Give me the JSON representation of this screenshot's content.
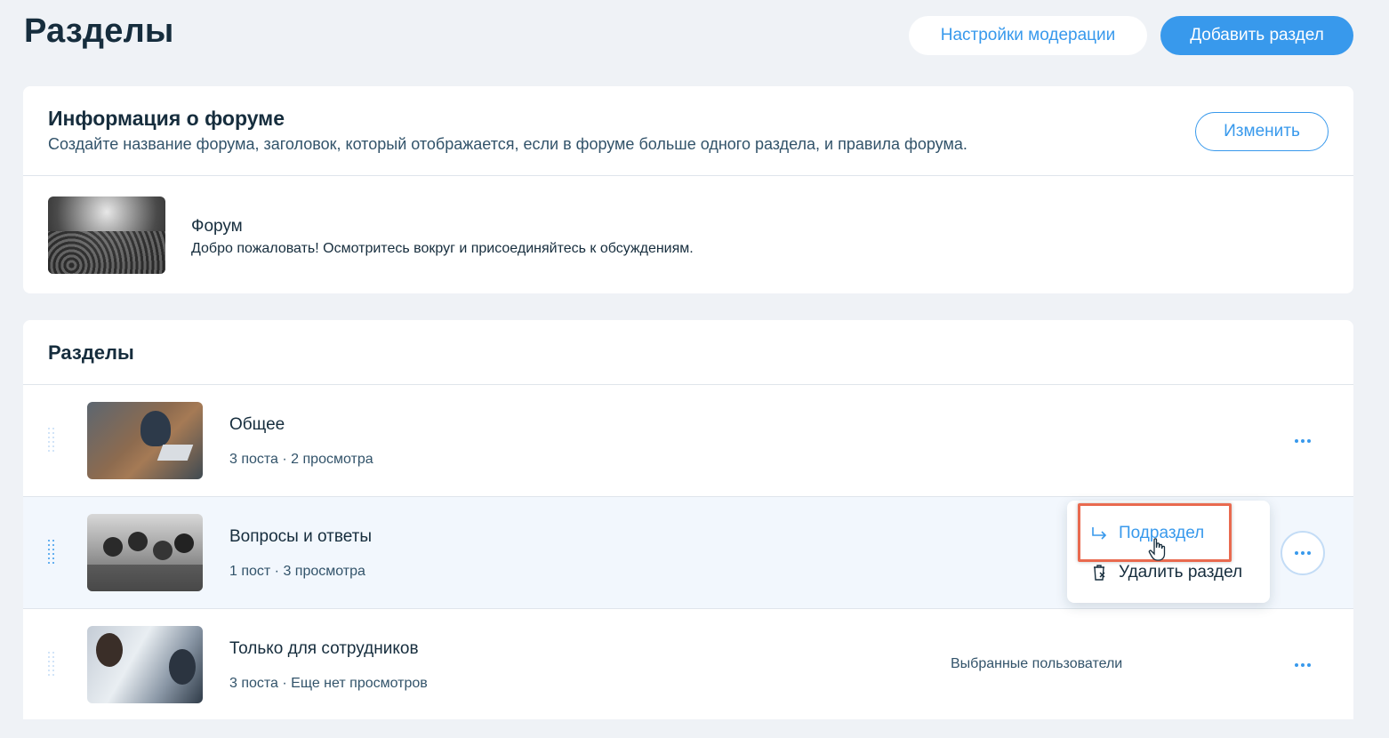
{
  "header": {
    "title": "Разделы",
    "moderation_button": "Настройки модерации",
    "add_section_button": "Добавить раздел"
  },
  "forum_info": {
    "title": "Информация о форуме",
    "description": "Создайте название форума, заголовок, который отображается, если в форуме больше одного раздела, и правила форума.",
    "edit_button": "Изменить",
    "forum_name": "Форум",
    "forum_welcome": "Добро пожаловать! Осмотритесь вокруг и присоединяйтесь к обсуждениям."
  },
  "sections": {
    "title": "Разделы",
    "items": [
      {
        "name": "Общее",
        "meta": "3 поста · 2 просмотра",
        "aside": ""
      },
      {
        "name": "Вопросы и ответы",
        "meta": "1 пост · 3 просмотра",
        "aside": ""
      },
      {
        "name": "Только для сотрудников",
        "meta": "3 поста · Еще нет просмотров",
        "aside": "Выбранные пользователи"
      }
    ]
  },
  "context_menu": {
    "subsection": "Подраздел",
    "delete_section": "Удалить раздел"
  },
  "icons": {
    "drag": "drag-handle-icon",
    "more": "more-dots-icon",
    "subsection": "subsection-arrow-icon",
    "delete": "delete-icon",
    "cursor": "hand-pointer-icon"
  },
  "colors": {
    "background": "#eff2f6",
    "accent": "#3899ec",
    "text_primary": "#162d3d",
    "text_secondary": "#32536a",
    "highlight": "#e96a4f"
  }
}
